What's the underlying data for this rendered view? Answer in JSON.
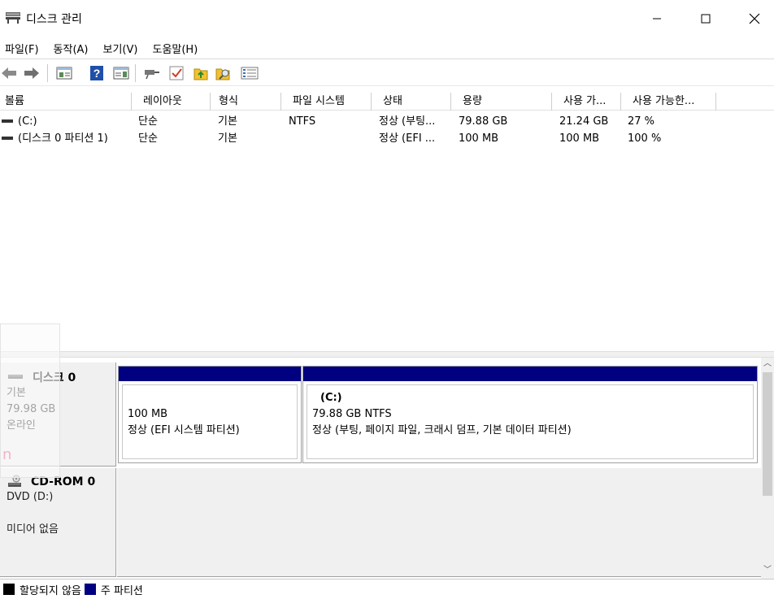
{
  "window": {
    "title": "디스크 관리",
    "controls": {
      "minimize": "—",
      "maximize": "☐",
      "close": "✕"
    }
  },
  "menu": [
    "파일(F)",
    "동작(A)",
    "보기(V)",
    "도움말(H)"
  ],
  "toolbar": {
    "icons": [
      "back-arrow-icon",
      "forward-arrow-icon",
      "console-tree-icon",
      "help-icon",
      "properties-panel-icon",
      "connect-icon",
      "check-icon",
      "export-icon",
      "search-folder-icon",
      "list-view-icon"
    ]
  },
  "volumes": {
    "columns": [
      "볼륨",
      "레이아웃",
      "형식",
      "파일 시스템",
      "상태",
      "용량",
      "사용 가...",
      "사용 가능한..."
    ],
    "rows": [
      [
        "(C:)",
        "단순",
        "기본",
        "NTFS",
        "정상 (부팅...",
        "79.88 GB",
        "21.24 GB",
        "27 %"
      ],
      [
        "(디스크 0 파티션 1)",
        "단순",
        "기본",
        "",
        "정상 (EFI ...",
        "100 MB",
        "100 MB",
        "100 %"
      ]
    ]
  },
  "ghost_text": "n",
  "disks": {
    "disk0": {
      "name": "디스크 0",
      "type": "기본",
      "size": "79.98 GB",
      "status": "온라인",
      "partitions": [
        {
          "name": "",
          "size": "100 MB",
          "status": "정상 (EFI 시스템 파티션)"
        },
        {
          "name": "(C:)",
          "size": "79.88 GB NTFS",
          "status": "정상 (부팅, 페이지 파일, 크래시 덤프, 기본 데이터 파티션)"
        }
      ]
    },
    "cdrom0": {
      "name": "CD-ROM 0",
      "drive": "DVD (D:)",
      "status": "미디어 없음"
    }
  },
  "legend": [
    {
      "label": "할당되지 않음",
      "color": "#000000"
    },
    {
      "label": "주 파티션",
      "color": "#000080"
    }
  ],
  "colors": {
    "primary_partition": "#000080",
    "unallocated": "#000000"
  }
}
